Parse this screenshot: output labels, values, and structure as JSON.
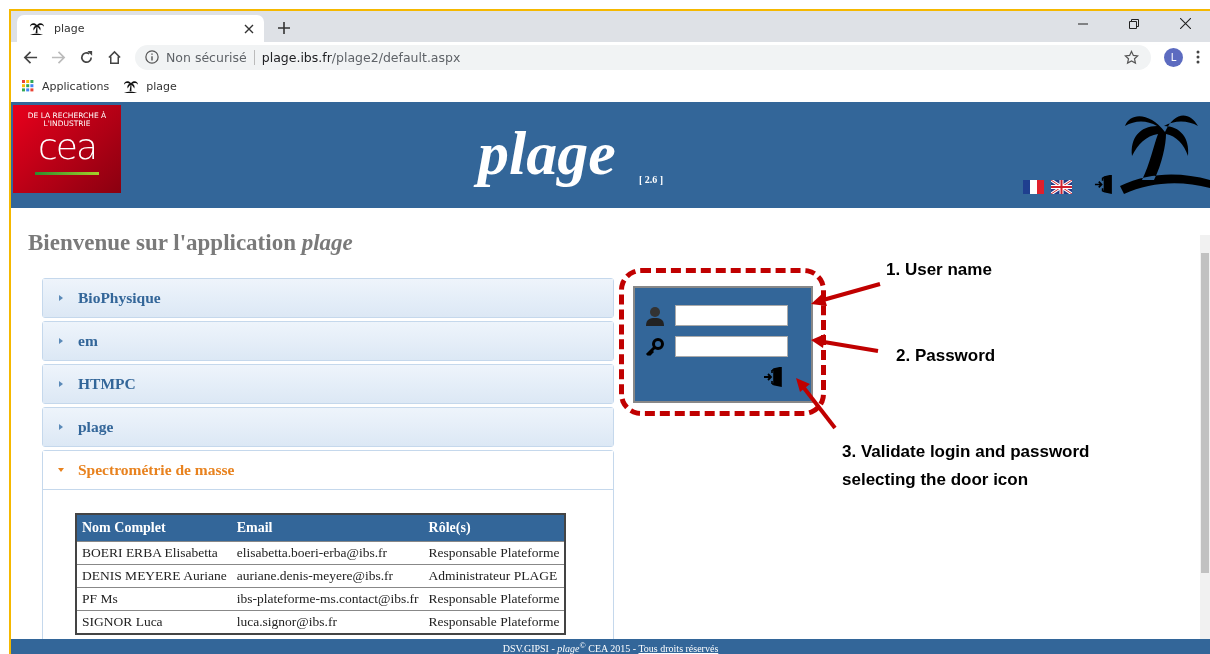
{
  "browser": {
    "tab": {
      "title": "plage",
      "selected": true
    },
    "address": {
      "security": "Non sécurisé",
      "host": "plage.ibs.fr",
      "path": "/plage2/default.aspx"
    },
    "profile_initial": "L",
    "bookmarks": [
      {
        "label": "Applications",
        "kind": "apps"
      },
      {
        "label": "plage",
        "kind": "site"
      }
    ]
  },
  "header": {
    "logo": {
      "tagline": "DE LA RECHERCHE À L'INDUSTRIE",
      "wordmark": "cea"
    },
    "title": "plage",
    "version": "[ 2.6 ]"
  },
  "page": {
    "heading": "Bienvenue sur l'application *plage*",
    "accordion": [
      {
        "label": "BioPhysique",
        "expanded": false
      },
      {
        "label": "em",
        "expanded": false
      },
      {
        "label": "HTMPC",
        "expanded": false
      },
      {
        "label": "plage",
        "expanded": false
      },
      {
        "label": "Spectrométrie de masse",
        "expanded": true,
        "table": {
          "columns": [
            "Nom Complet",
            "Email",
            "Rôle(s)"
          ],
          "rows": [
            [
              "BOERI ERBA Elisabetta",
              "elisabetta.boeri-erba@ibs.fr",
              "Responsable Plateforme"
            ],
            [
              "DENIS MEYERE Auriane",
              "auriane.denis-meyere@ibs.fr",
              "Administrateur PLAGE"
            ],
            [
              "PF Ms",
              "ibs-plateforme-ms.contact@ibs.fr",
              "Responsable Plateforme"
            ],
            [
              "SIGNOR Luca",
              "luca.signor@ibs.fr",
              "Responsable Plateforme"
            ]
          ]
        }
      }
    ],
    "login": {
      "kind": "form"
    },
    "annotations": [
      "1. User name",
      "2. Password",
      "3. Validate login and password selecting the door icon"
    ]
  },
  "footer": {
    "text": "DSV.GIPSI - *plage*$^{©}$ CEA 2015 - ",
    "link": "Tous droits réservés"
  }
}
